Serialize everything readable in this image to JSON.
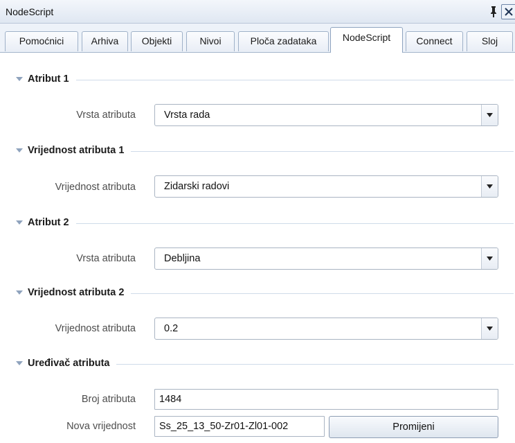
{
  "window": {
    "title": "NodeScript",
    "pin_icon": "pin-icon",
    "close_icon": "close-icon"
  },
  "tabs": [
    {
      "label": "Pomoćnici",
      "active": false
    },
    {
      "label": "Arhiva",
      "active": false
    },
    {
      "label": "Objekti",
      "active": false
    },
    {
      "label": "Nivoi",
      "active": false
    },
    {
      "label": "Ploča zadataka",
      "active": false
    },
    {
      "label": "NodeScript",
      "active": true
    },
    {
      "label": "Connect",
      "active": false
    },
    {
      "label": "Sloj",
      "active": false
    }
  ],
  "sections": {
    "attr1": {
      "title": "Atribut 1",
      "field_label": "Vrsta atributa",
      "value": "Vrsta rada"
    },
    "attr1_value": {
      "title": "Vrijednost atributa 1",
      "field_label": "Vrijednost atributa",
      "value": "Zidarski radovi"
    },
    "attr2": {
      "title": "Atribut 2",
      "field_label": "Vrsta atributa",
      "value": "Debljina"
    },
    "attr2_value": {
      "title": "Vrijednost atributa 2",
      "field_label": "Vrijednost atributa",
      "value": "0.2"
    },
    "editor": {
      "title": "Uređivač atributa",
      "count_label": "Broj atributa",
      "count_value": "1484",
      "new_value_label": "Nova vrijednost",
      "new_value": "Ss_25_13_50-Zr01-Zl01-002",
      "change_button": "Promijeni"
    }
  },
  "colors": {
    "accent_border": "#9fb1c8",
    "section_rule": "#cfdbe9"
  }
}
